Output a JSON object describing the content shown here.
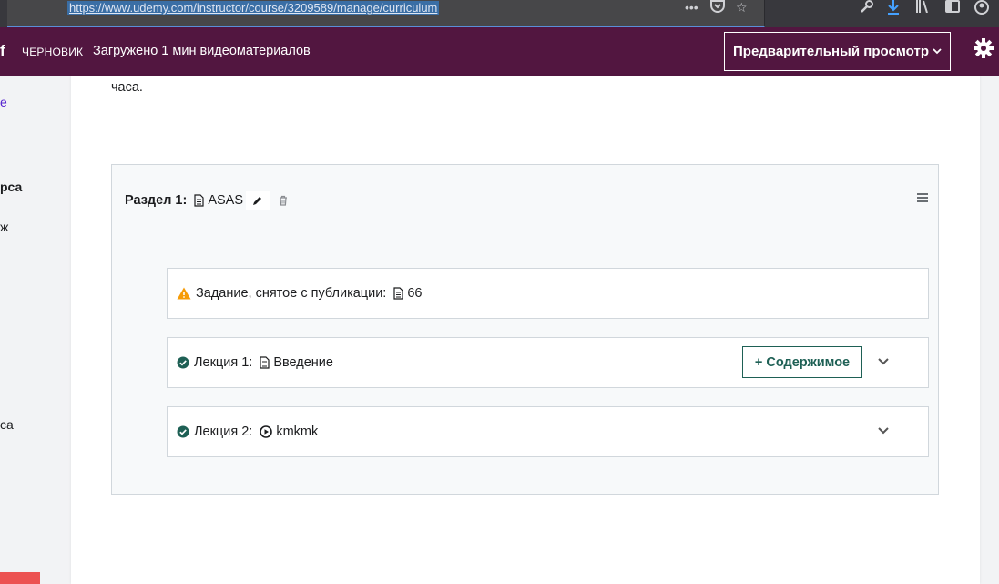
{
  "browser": {
    "url": "https://www.udemy.com/instructor/course/3209589/manage/curriculum"
  },
  "header": {
    "brand_fragment": "f",
    "draft_label": "ЧЕРНОВИК",
    "upload_status": "Загружено 1 мин видеоматериалов",
    "preview_label": "Предварительный просмотр"
  },
  "sidebar": {
    "fragments": [
      "e",
      "рса",
      "ж",
      "са"
    ]
  },
  "content": {
    "cut_text": "часа."
  },
  "section": {
    "label": "Раздел 1:",
    "title": "ASAS"
  },
  "items": [
    {
      "label": "Задание, снятое с публикации:",
      "title": "66",
      "status": "warning"
    },
    {
      "label": "Лекция 1:",
      "title": "Введение",
      "status": "published",
      "content_button": "+ Содержимое"
    },
    {
      "label": "Лекция 2:",
      "title": "kmkmk",
      "status": "published"
    }
  ],
  "colors": {
    "header_bg": "#521640",
    "accent_teal": "#1e6055",
    "warning": "#f69c08",
    "danger": "#ec5252"
  }
}
